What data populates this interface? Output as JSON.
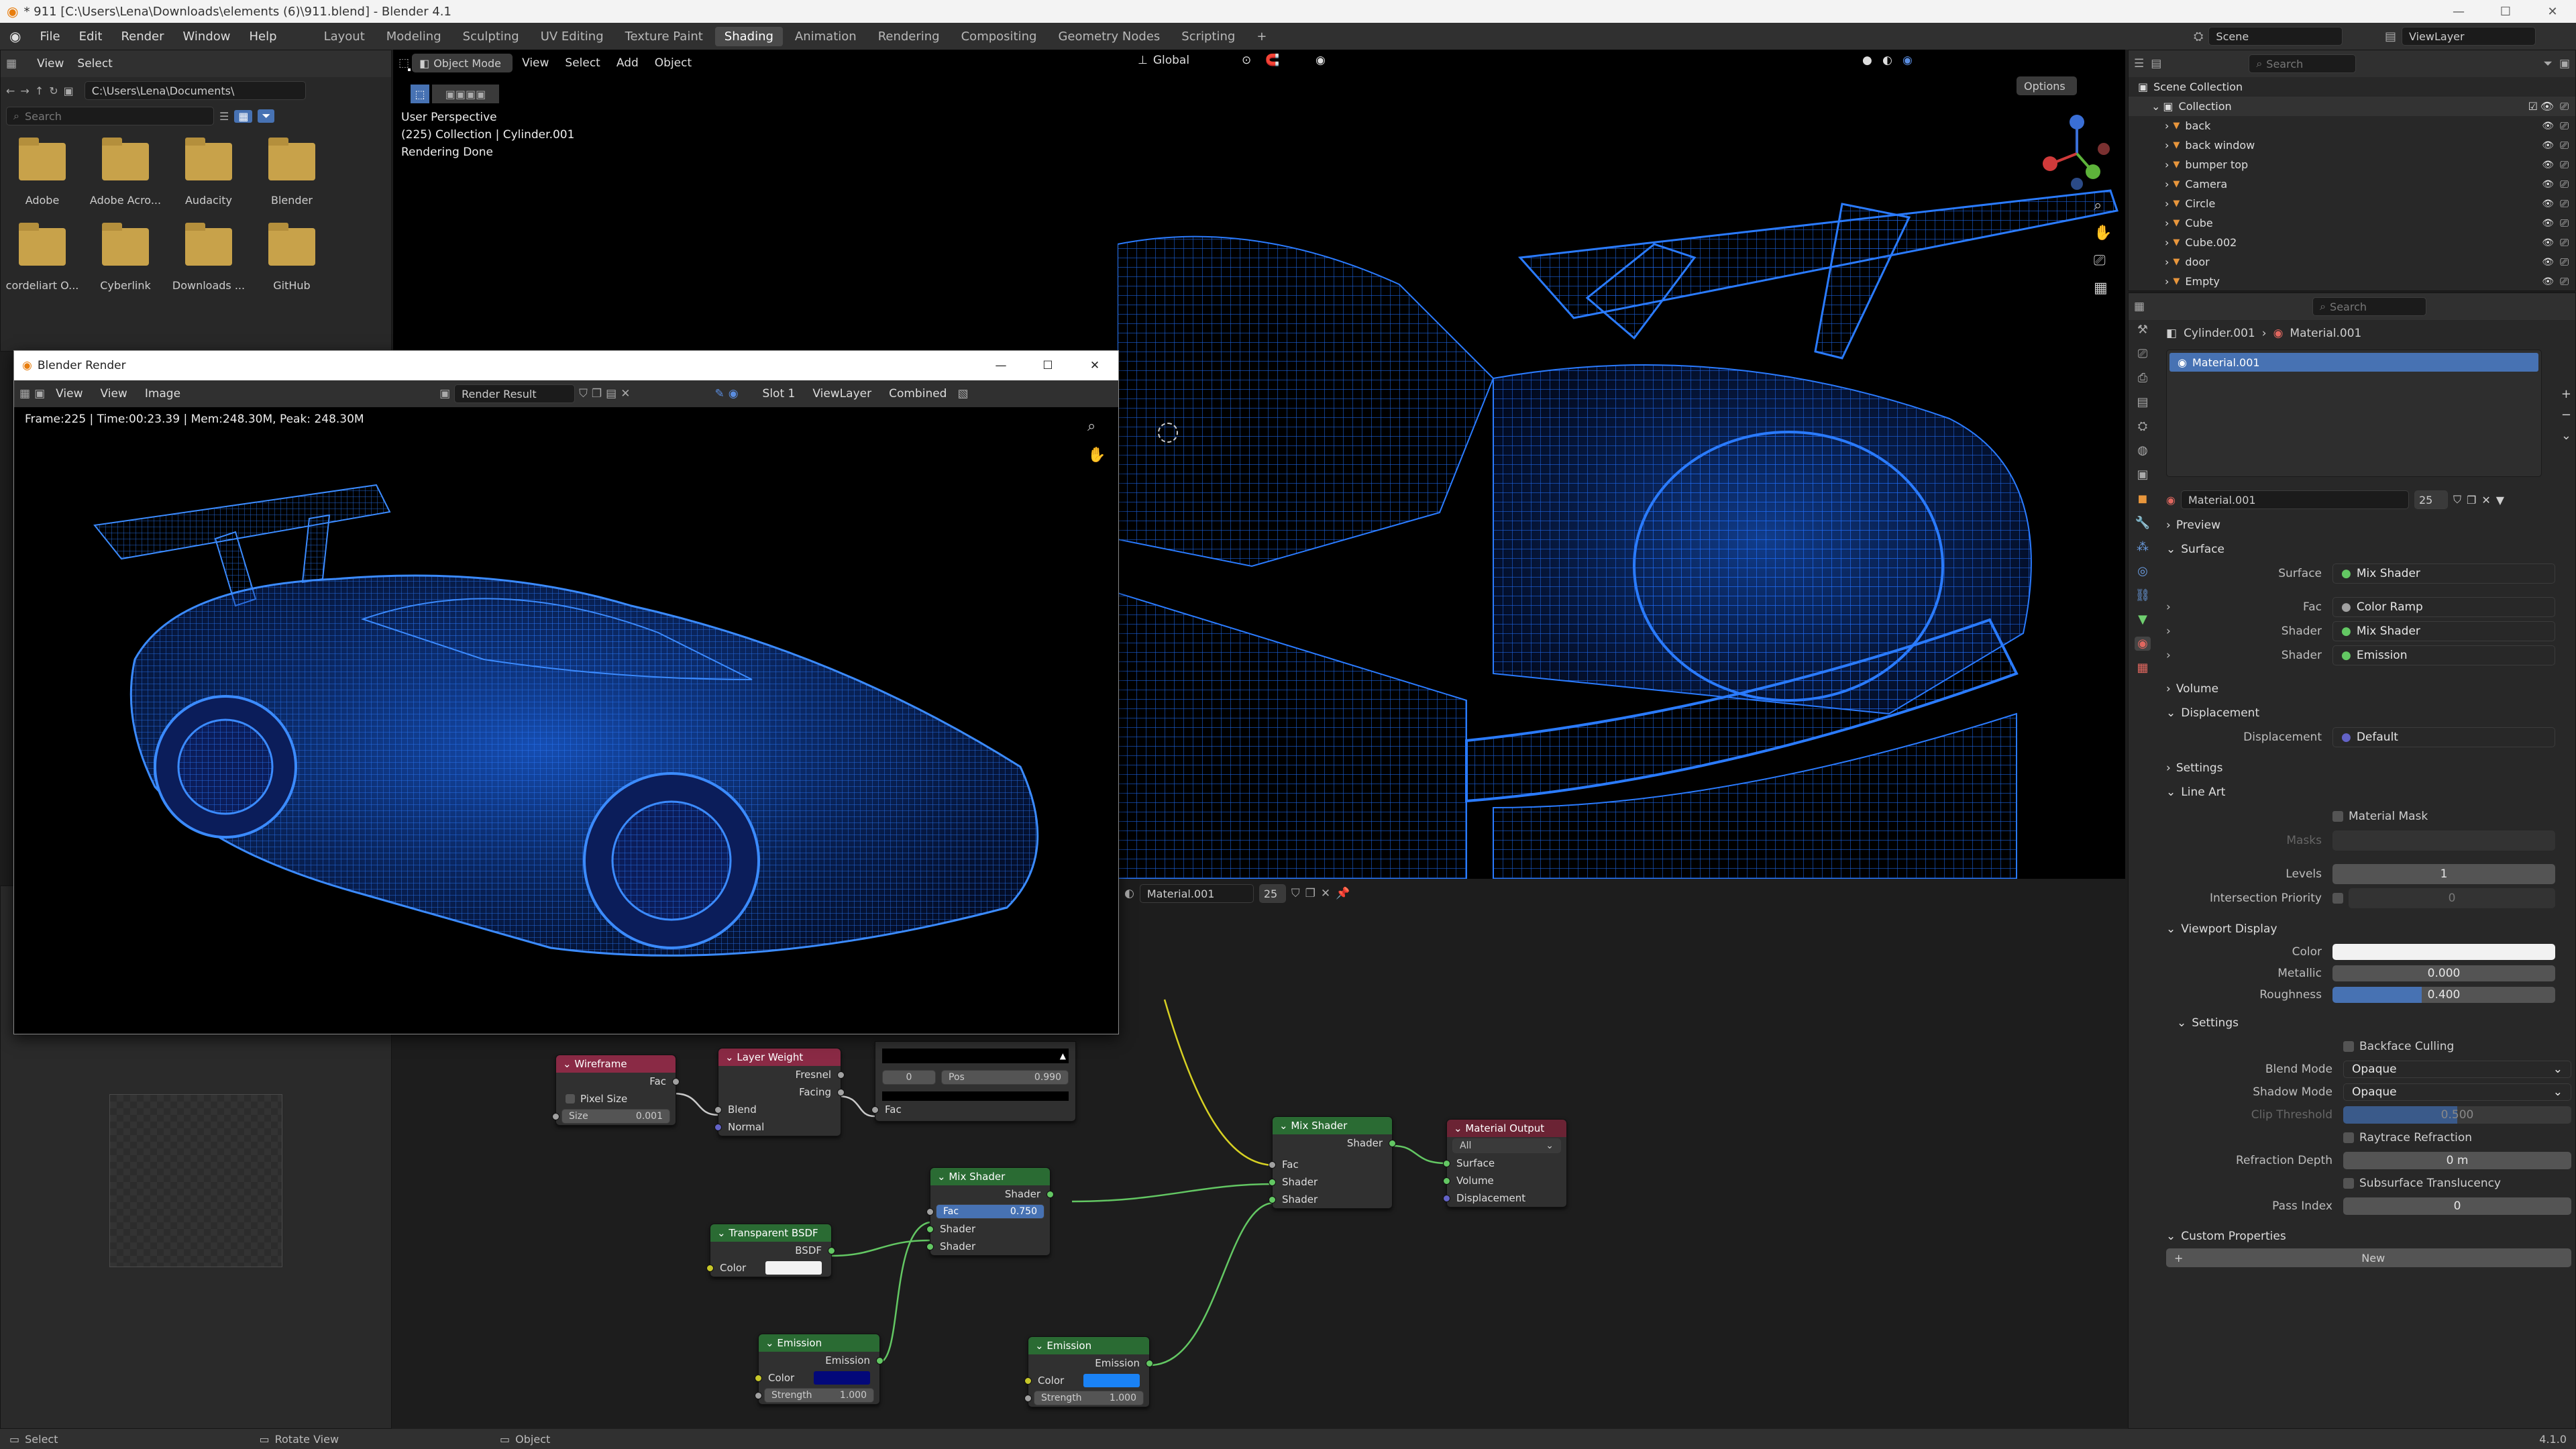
{
  "window": {
    "title": "* 911 [C:\\Users\\Lena\\Downloads\\elements (6)\\911.blend] - Blender 4.1"
  },
  "menus": [
    "File",
    "Edit",
    "Render",
    "Window",
    "Help"
  ],
  "workspaces": [
    "Layout",
    "Modeling",
    "Sculpting",
    "UV Editing",
    "Texture Paint",
    "Shading",
    "Animation",
    "Rendering",
    "Compositing",
    "Geometry Nodes",
    "Scripting"
  ],
  "active_workspace": "Shading",
  "scene": {
    "name": "Scene",
    "view_layer": "ViewLayer"
  },
  "file_browser": {
    "menu_view": "View",
    "menu_select": "Select",
    "path": "C:\\Users\\Lena\\Documents\\",
    "search_placeholder": "Search",
    "items": [
      "Adobe",
      "Adobe Acro...",
      "Audacity",
      "Blender",
      "cordeliart O...",
      "Cyberlink",
      "Downloads ...",
      "GitHub"
    ]
  },
  "viewport": {
    "mode": "Object Mode",
    "menu_view": "View",
    "menu_select": "Select",
    "menu_add": "Add",
    "menu_object": "Object",
    "transform": "Global",
    "options": "Options",
    "info_line1": "User Perspective",
    "info_line2": "(225) Collection | Cylinder.001",
    "info_line3": "Rendering Done"
  },
  "render_window": {
    "title": "Blender Render",
    "menu_view": "View",
    "menu_view2": "View",
    "menu_image": "Image",
    "image_name": "Render Result",
    "slot": "Slot 1",
    "view_layer": "ViewLayer",
    "pass": "Combined",
    "stats": "Frame:225 | Time:00:23.39 | Mem:248.30M, Peak: 248.30M"
  },
  "node_editor": {
    "material": "Material.001",
    "users": "25",
    "nodes": {
      "wireframe": {
        "title": "Wireframe",
        "out": "Fac",
        "pixel_size": "Pixel Size",
        "size_label": "Size",
        "size_value": "0.001"
      },
      "layer_weight": {
        "title": "Layer Weight",
        "out1": "Fresnel",
        "out2": "Facing",
        "in1": "Blend",
        "in2": "Normal"
      },
      "color_ramp": {
        "left_val": "0",
        "pos_label": "Pos",
        "pos_val": "0.990",
        "in": "Fac"
      },
      "mix_shader_1": {
        "title": "Mix Shader",
        "out": "Shader",
        "fac_label": "Fac",
        "fac_value": "0.750",
        "in1": "Shader",
        "in2": "Shader"
      },
      "mix_shader_2": {
        "title": "Mix Shader",
        "out": "Shader",
        "in0": "Fac",
        "in1": "Shader",
        "in2": "Shader"
      },
      "transparent": {
        "title": "Transparent BSDF",
        "out": "BSDF",
        "color": "Color"
      },
      "emission_1": {
        "title": "Emission",
        "out": "Emission",
        "color": "Color",
        "strength_label": "Strength",
        "strength": "1.000"
      },
      "emission_2": {
        "title": "Emission",
        "out": "Emission",
        "color": "Color",
        "strength_label": "Strength",
        "strength": "1.000"
      },
      "output": {
        "title": "Material Output",
        "target": "All",
        "in1": "Surface",
        "in2": "Volume",
        "in3": "Displacement"
      }
    }
  },
  "outliner": {
    "search_placeholder": "Search",
    "root": "Scene Collection",
    "collection": "Collection",
    "items": [
      "back",
      "back window",
      "bumper top",
      "Camera",
      "Circle",
      "Cube",
      "Cube.002",
      "door",
      "Empty"
    ]
  },
  "properties": {
    "search_placeholder": "Search",
    "breadcrumb_object": "Cylinder.001",
    "breadcrumb_material": "Material.001",
    "slot_item": "Material.001",
    "material_name": "Material.001",
    "material_users": "25",
    "sections": {
      "preview": "Preview",
      "surface": "Surface",
      "volume": "Volume",
      "displacement": "Displacement",
      "settings": "Settings",
      "line_art": "Line Art",
      "viewport_display": "Viewport Display",
      "settings2": "Settings",
      "custom_props": "Custom Properties"
    },
    "surface": {
      "surface_label": "Surface",
      "surface_val": "Mix Shader",
      "fac_label": "Fac",
      "fac_val": "Color Ramp",
      "shader1_label": "Shader",
      "shader1_val": "Mix Shader",
      "shader2_label": "Shader",
      "shader2_val": "Emission"
    },
    "displacement": {
      "label": "Displacement",
      "val": "Default"
    },
    "line_art": {
      "material_mask": "Material Mask",
      "masks": "Masks",
      "levels_label": "Levels",
      "levels": "1",
      "intersection_label": "Intersection Priority",
      "intersection": "0"
    },
    "viewport_display": {
      "color_label": "Color",
      "metallic_label": "Metallic",
      "metallic": "0.000",
      "roughness_label": "Roughness",
      "roughness": "0.400"
    },
    "settings": {
      "backface": "Backface Culling",
      "blend_label": "Blend Mode",
      "blend": "Opaque",
      "shadow_label": "Shadow Mode",
      "shadow": "Opaque",
      "clip_label": "Clip Threshold",
      "clip": "0.500",
      "raytrace": "Raytrace Refraction",
      "refraction_label": "Refraction Depth",
      "refraction": "0 m",
      "sss": "Subsurface Translucency",
      "pass_label": "Pass Index",
      "pass": "0"
    },
    "custom_new": "New"
  },
  "status": {
    "select": "Select",
    "rotate": "Rotate View",
    "object": "Object",
    "version": "4.1.0"
  },
  "colors": {
    "accent": "#4772b3",
    "wire": "#1f6fff",
    "shader_header": "#2a6b33",
    "input_header": "#8a2a45",
    "output_header": "#6b2334"
  }
}
